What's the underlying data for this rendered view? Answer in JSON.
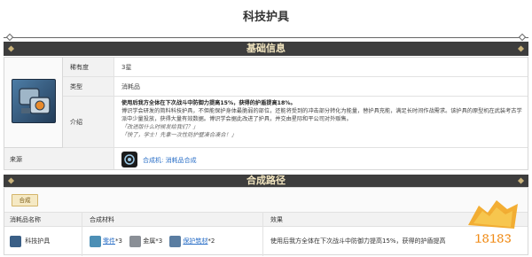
{
  "page": {
    "title": "科技护具"
  },
  "basic_info": {
    "header": "基础信息",
    "rows": [
      {
        "key": "稀有度",
        "value": "3星"
      },
      {
        "key": "类型",
        "value": "消耗品"
      }
    ],
    "intro": {
      "key": "介绍",
      "effect": "使用后我方全体在下次战斗中防御力提高15%，获得的护盾提高18%。",
      "body": "博识学会研发的简料科技护具，不但能保护身体最脆弱的部位，还能将受到的冲击部分转化为能量，替护具充能，满足长时间作战需求。该护具的原型机在武装考古学派中少量投放，获得大量有效数据。博识学会据此改进了护具，并交由星际和平公司对外贩售。",
      "quote1": "「改进版什么时候发给我们？」",
      "quote2": "「快了，学士！先拿一次性防护壁凑合凑合！」"
    },
    "source": {
      "key": "来源",
      "link": "合成机: 消耗品合成"
    }
  },
  "crafting": {
    "header": "合成路径",
    "tab": "合成",
    "columns": [
      "消耗品名称",
      "合成材料",
      "效果"
    ],
    "row": {
      "name": "科技护具",
      "materials": [
        {
          "name": "零件",
          "count": "*3",
          "linked": true
        },
        {
          "name": "金属",
          "count": "*3",
          "linked": false
        },
        {
          "name": "保护筑材",
          "count": "*2",
          "linked": true
        }
      ],
      "effect": "使用后我方全体在下次战斗中防御力提高15%，获得的护盾提高"
    }
  },
  "watermark": {
    "text": "18183"
  }
}
